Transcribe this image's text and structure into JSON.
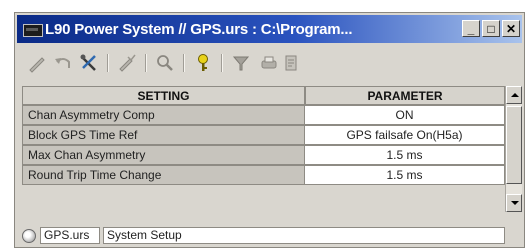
{
  "window": {
    "title": "L90 Power System // GPS.urs : C:\\Program...",
    "controls": {
      "minimize": "_",
      "maximize": "□",
      "close": "✕"
    }
  },
  "toolbar": {
    "icons": [
      "pencil-icon",
      "undo-icon",
      "tools-icon",
      "edit-check-icon",
      "search-icon",
      "help-key-icon",
      "filter-icon",
      "print-icon",
      "document-icon"
    ]
  },
  "grid": {
    "headers": {
      "setting": "SETTING",
      "parameter": "PARAMETER"
    },
    "rows": [
      {
        "setting": "Chan Asymmetry Comp",
        "parameter": "ON"
      },
      {
        "setting": "Block GPS Time Ref",
        "parameter": "GPS failsafe On(H5a)"
      },
      {
        "setting": "Max Chan Asymmetry",
        "parameter": "1.5 ms"
      },
      {
        "setting": "Round Trip Time Change",
        "parameter": "1.5 ms"
      }
    ]
  },
  "statusbar": {
    "file": "GPS.urs",
    "section": "System Setup"
  },
  "colors": {
    "titlebar_start": "#0a2a86",
    "titlebar_end": "#a9c3ec",
    "window_bg": "#d9d6cf",
    "setting_cell_bg": "#c7c4bd",
    "parameter_cell_bg": "#ffffff"
  }
}
